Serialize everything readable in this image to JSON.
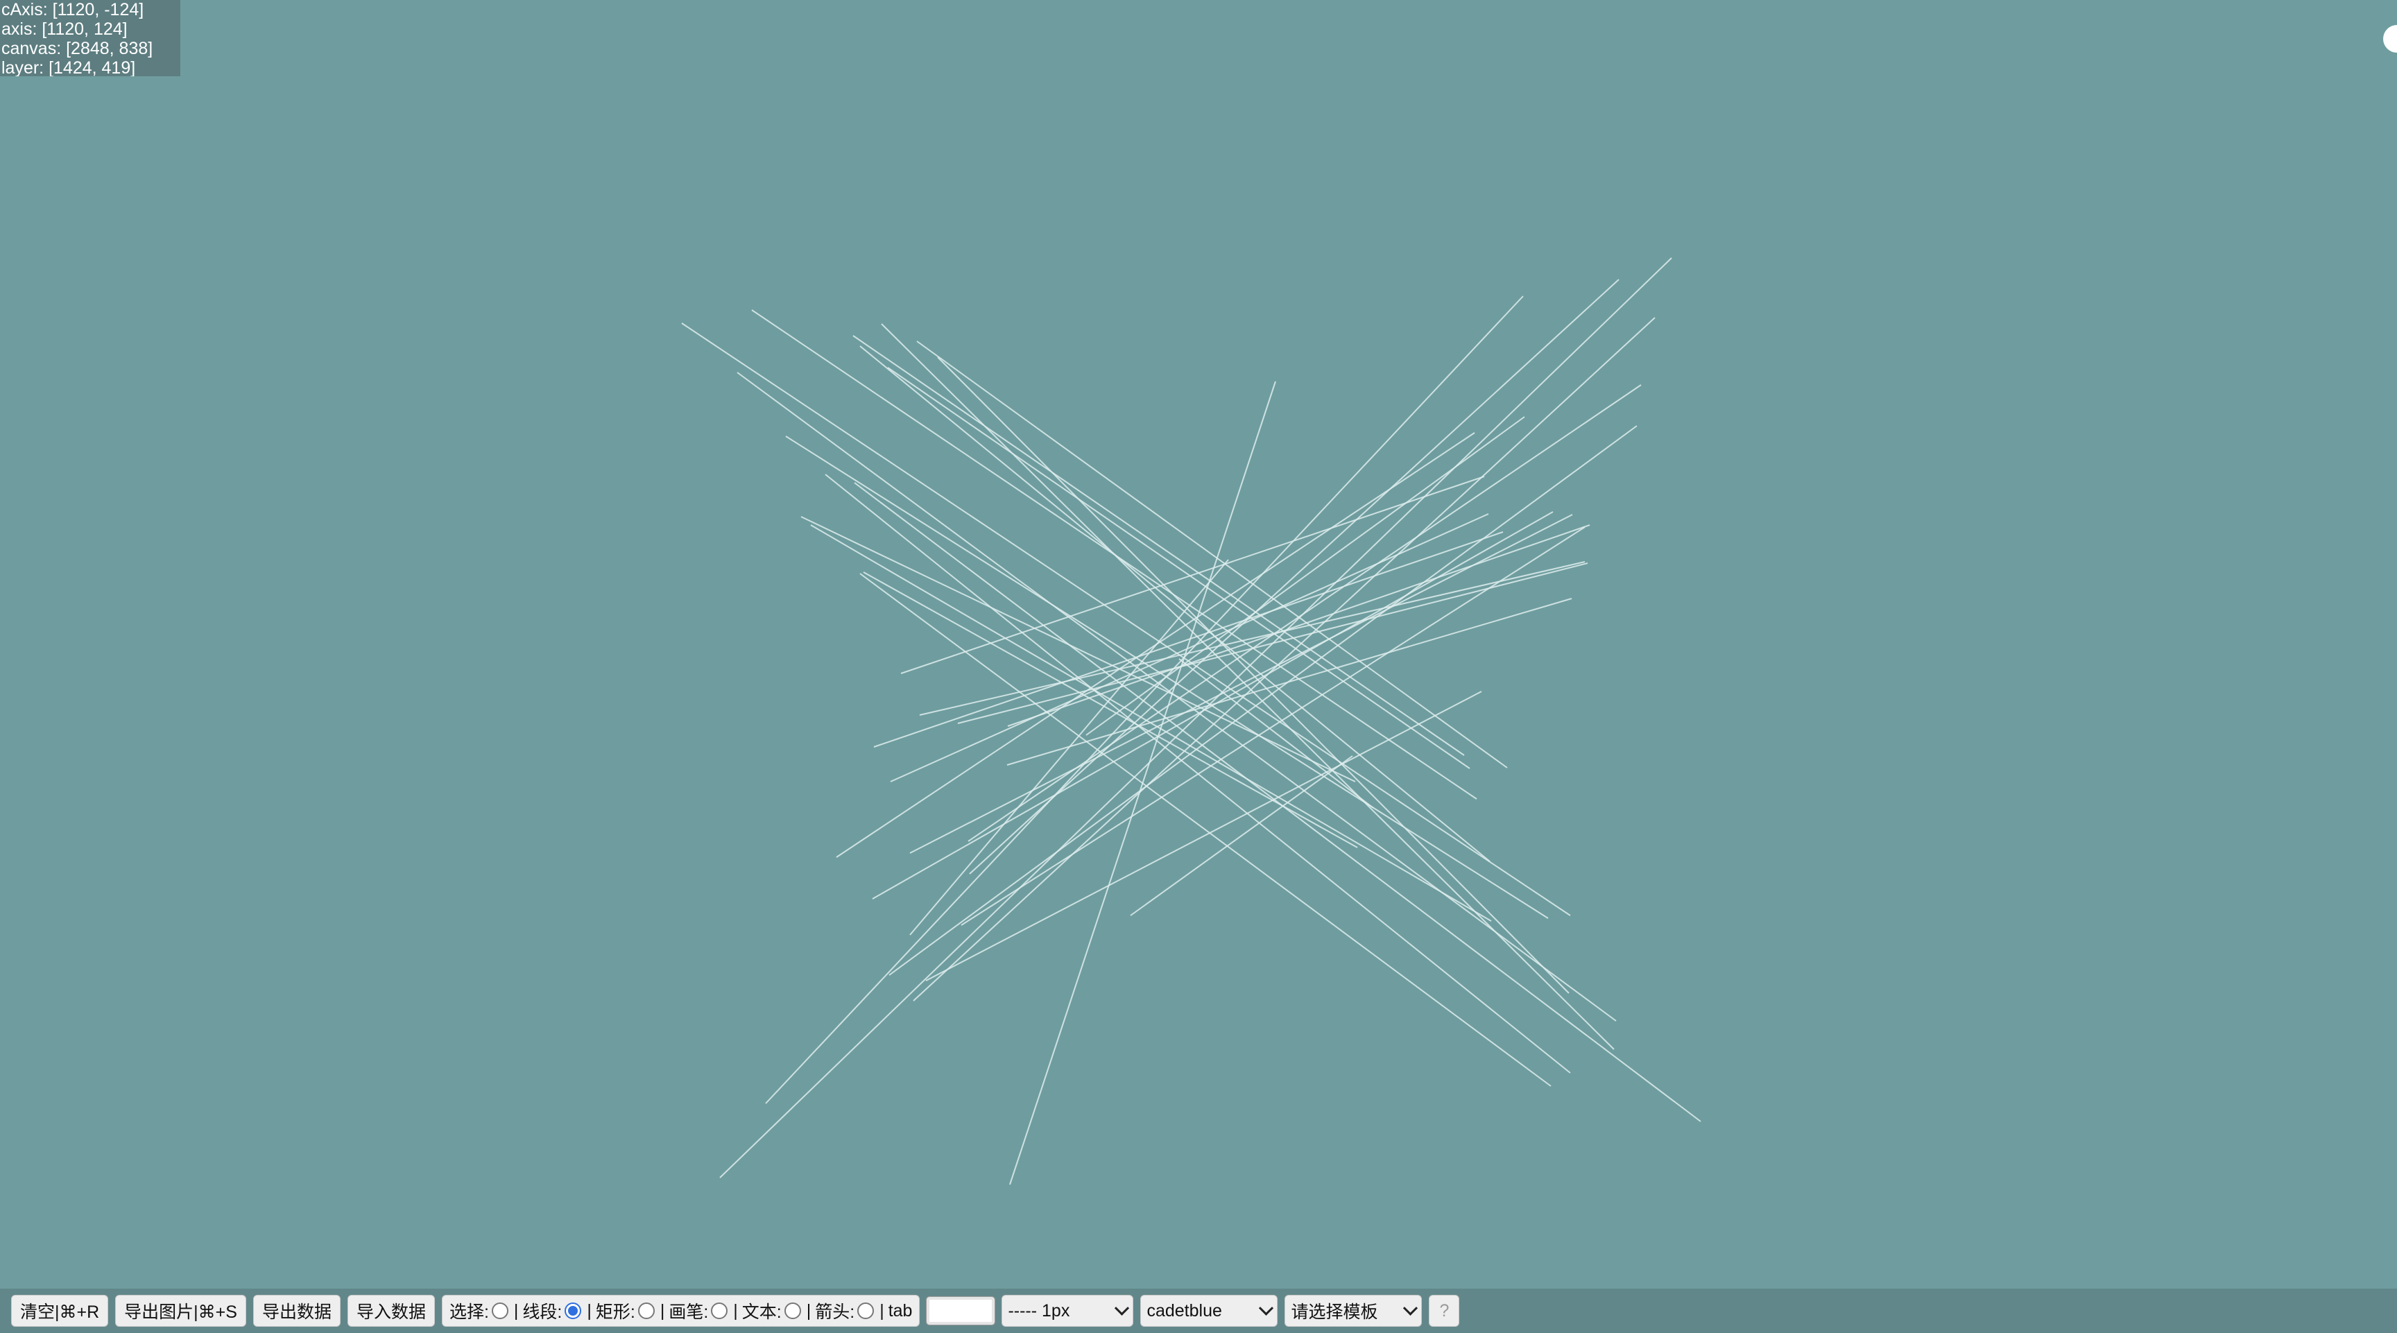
{
  "debug": {
    "caxis": "cAxis: [1120, -124]",
    "axis": "axis: [1120, 124]",
    "canvas": "canvas: [2848, 838]",
    "layer": "layer: [1424, 419]"
  },
  "canvas": {
    "background": "#6f9d9f",
    "stroke_color": "#dfeeee"
  },
  "toolbar": {
    "clear_label": "清空|⌘+R",
    "export_image_label": "导出图片|⌘+S",
    "export_data_label": "导出数据",
    "import_data_label": "导入数据",
    "modes": [
      {
        "label": "选择:",
        "checked": false
      },
      {
        "label": "线段:",
        "checked": true
      },
      {
        "label": "矩形:",
        "checked": false
      },
      {
        "label": "画笔:",
        "checked": false
      },
      {
        "label": "文本:",
        "checked": false
      },
      {
        "label": "箭头:",
        "checked": false
      }
    ],
    "tab_label": "tab",
    "color_value": "#ffffff",
    "line_width_value": "----- 1px",
    "theme_value": "cadetblue",
    "template_placeholder": "请选择模板",
    "help_label": "?"
  }
}
